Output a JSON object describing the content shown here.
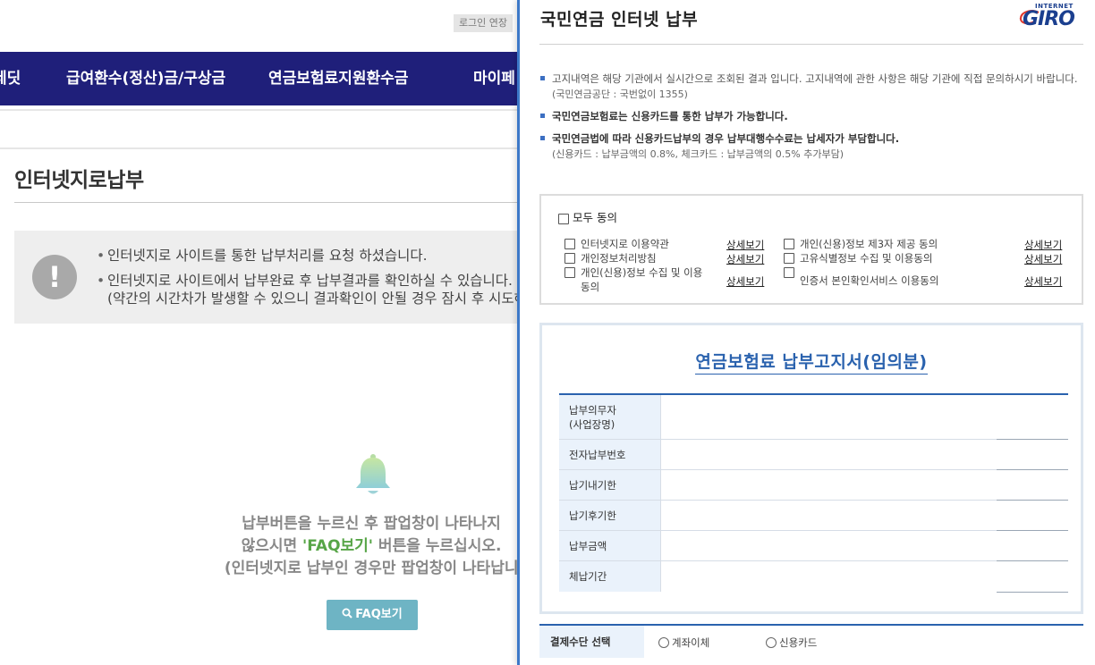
{
  "background": {
    "login_extend": "로그인 연장",
    "nav": [
      "레딧",
      "급여환수(정산)금/구상금",
      "연금보험료지원환수금",
      "마이페"
    ],
    "page_title": "인터넷지로납부",
    "notices": [
      "인터넷지로 사이트를 통한 납부처리를 요청 하셨습니다.",
      "인터넷지로 사이트에서 납부완료 후 납부결과를 확인하실 수 있습니다.",
      "(약간의 시간차가 발생할 수 있으니 결과확인이 안될 경우 잠시 후 시도해"
    ],
    "notice_icon": "exclamation-icon",
    "info_line1": "납부버튼을 누르신 후 팝업창이 나타나지",
    "info_line2_pre": "않으시면 ",
    "info_line2_em": "'FAQ보기'",
    "info_line2_post": " 버튼을 누르십시오.",
    "info_line3": "(인터넷지로 납부인 경우만 팝업창이 나타납니다",
    "faq_button": "FAQ보기",
    "colors": {
      "nav_bg": "#1f1f7a",
      "faq_bg": "#6eb4c4",
      "faq_em": "#57a547"
    }
  },
  "popup": {
    "title": "국민연금 인터넷 납부",
    "logo_top": "INTERNET",
    "logo_main": "GIRO",
    "bullets": {
      "b1": "고지내역은 해당 기관에서 실시간으로 조회된 결과 입니다. 고지내역에 관한 사항은 해당 기관에 직접 문의하시기 바랍니다.",
      "b1_sub": "(국민연금공단 : 국번없이 1355)",
      "b2": "국민연금보험료는 신용카드를 통한 납부가 가능합니다.",
      "b3": "국민연금법에 따라 신용카드납부의 경우 납부대행수수료는 납세자가 부담합니다.",
      "b3_sub": "(신용카드 : 납부금액의 0.8%, 체크카드 : 납부금액의 0.5% 추가부담)"
    },
    "agree_all": "모두 동의",
    "agree_items": [
      "인터넷지로 이용약관",
      "개인정보처리방침",
      "개인(신용)정보 수집 및 이용",
      "동의",
      "개인(신용)정보 제3자 제공 동의",
      "고유식별정보 수집 및 이용동의",
      "인증서 본인확인서비스 이용동의"
    ],
    "detail_link": "상세보기",
    "form_title": "연금보험료 납부고지서(임의분)",
    "form_rows": [
      {
        "label1": "납부의무자",
        "label2": "(사업장명)"
      },
      {
        "label1": "전자납부번호",
        "label2": ""
      },
      {
        "label1": "납기내기한",
        "label2": ""
      },
      {
        "label1": "납기후기한",
        "label2": ""
      },
      {
        "label1": "납부금액",
        "label2": ""
      },
      {
        "label1": "체납기간",
        "label2": ""
      }
    ],
    "pay_method_label": "결제수단 선택",
    "pay_options": [
      "계좌이체",
      "신용카드"
    ],
    "colors": {
      "accent": "#2a62ae",
      "border": "#3c78c8",
      "th_bg": "#eaf2fb"
    }
  }
}
